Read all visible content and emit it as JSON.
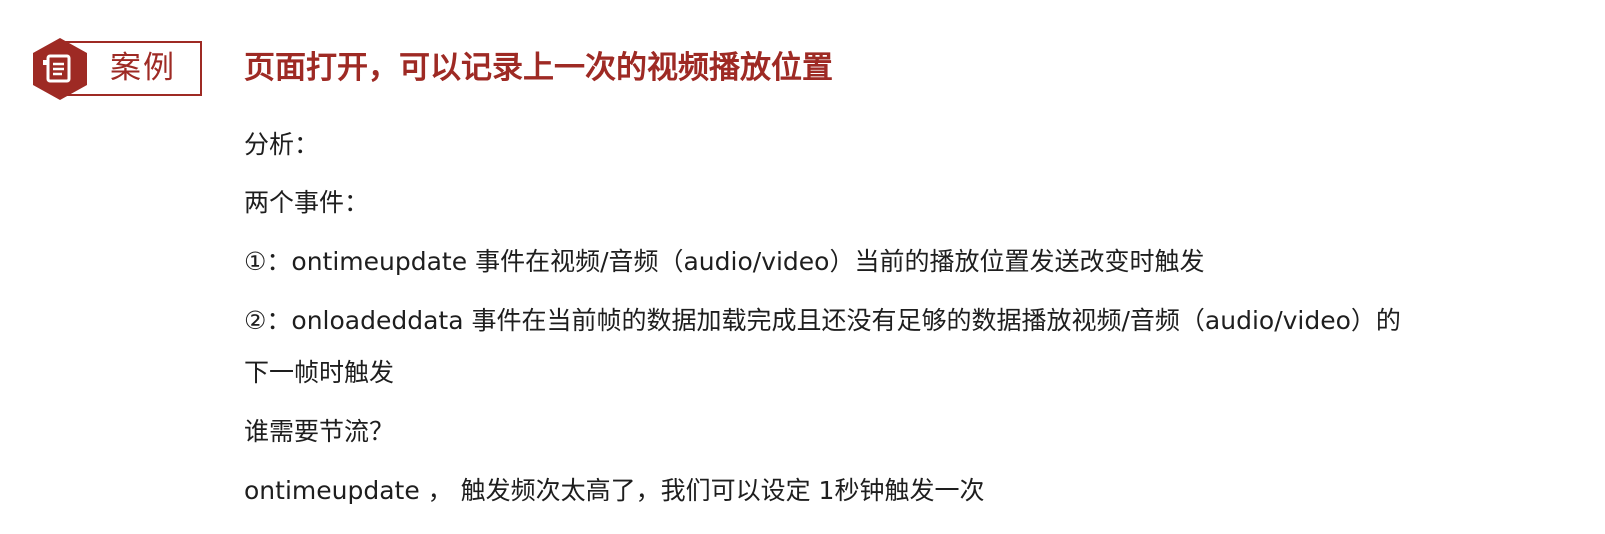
{
  "header": {
    "badge_label": "案例",
    "title": "页面打开，可以记录上一次的视频播放位置",
    "accent_color": "#9e2a24",
    "badge_icon": "document-icon"
  },
  "content": {
    "lines": [
      "分析：",
      "两个事件：",
      "①：ontimeupdate   事件在视频/音频（audio/video）当前的播放位置发送改变时触发",
      "②：onloadeddata 事件在当前帧的数据加载完成且还没有足够的数据播放视频/音频（audio/video）的",
      "下一帧时触发",
      "谁需要节流？",
      "ontimeupdate ，  触发频次太高了，我们可以设定 1秒钟触发一次"
    ]
  }
}
